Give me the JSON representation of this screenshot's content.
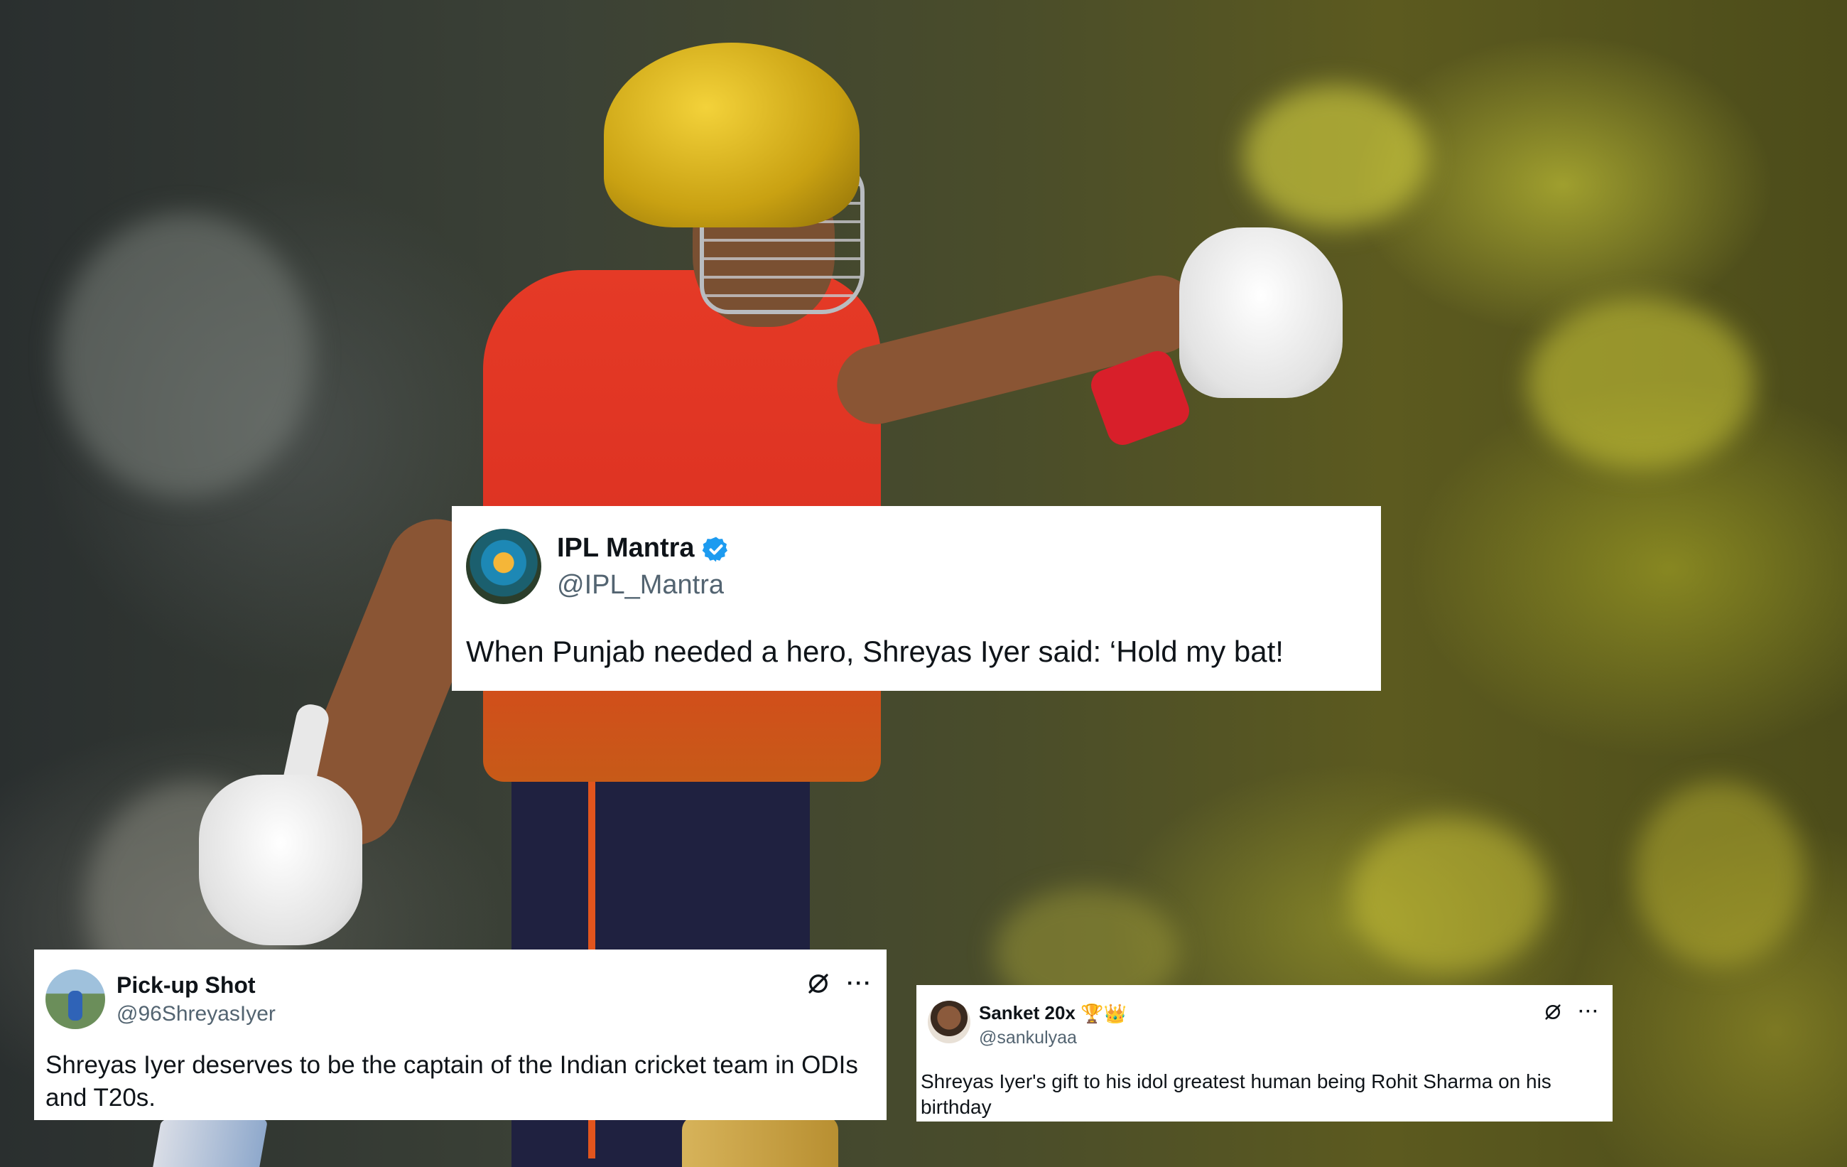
{
  "photo": {
    "description_icon": "cricket-player-celebrating"
  },
  "tweets": {
    "main": {
      "display_name": "IPL Mantra",
      "handle": "@IPL_Mantra",
      "verified": true,
      "text": "When Punjab needed a hero, Shreyas Iyer said: ‘Hold my bat!"
    },
    "left": {
      "display_name": "Pick-up Shot",
      "handle": "@96ShreyasIyer",
      "text": "Shreyas Iyer deserves to be the captain of the Indian cricket team in ODIs and T20s.",
      "more_label": "···"
    },
    "right": {
      "display_name": "Sanket 20x",
      "name_emoji": "🏆👑",
      "handle": "@sankulyaa",
      "text": "Shreyas Iyer's gift to his idol greatest human being Rohit Sharma on his birthday",
      "more_label": "···"
    }
  },
  "colors": {
    "verified_blue": "#1d9bf0",
    "handle_grey": "#536471",
    "text_dark": "#0f1419"
  }
}
